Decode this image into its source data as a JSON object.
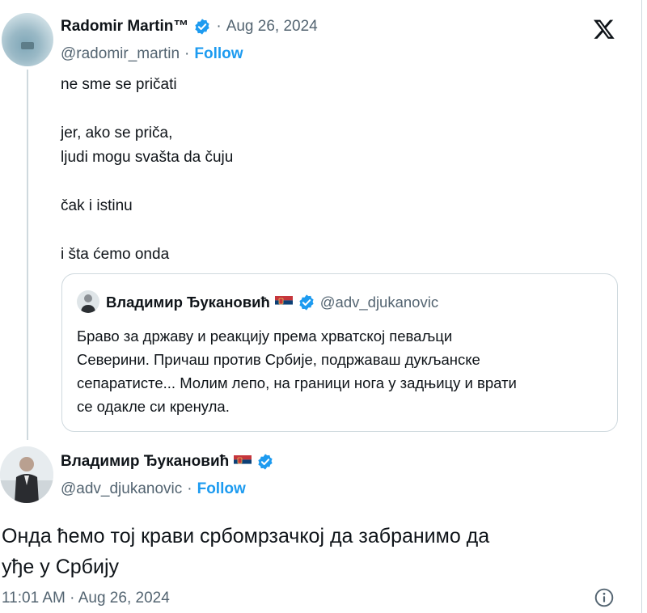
{
  "tweet1": {
    "name": "Radomir Martin™",
    "date": "Aug 26, 2024",
    "handle": "@radomir_martin",
    "follow": "Follow",
    "text": "ne sme se pričati\n\njer, ako se priča,\nljudi mogu svašta da čuju\n\nčak i istinu\n\ni šta ćemo onda"
  },
  "quoted": {
    "name": "Владимир Ђукановић",
    "handle": "@adv_djukanovic",
    "text": "Браво за државу и реакцију према хрватској певаљци\nСеверини. Причаш против Србије, подржаваш дукљанске\nсепаратисте... Молим лепо, на граници нога у задњицу и врати\nсе одакле си кренула."
  },
  "tweet2": {
    "name": "Владимир Ђукановић",
    "handle": "@adv_djukanovic",
    "follow": "Follow",
    "text": "Онда ћемо тој крави србомрзачкој да забранимо да\nуђе у Србију",
    "time": "11:01 AM",
    "date": "Aug 26, 2024"
  },
  "icons": {
    "verified_color": "#1d9bf0",
    "logo": "x-logo-icon",
    "info": "info-icon"
  }
}
